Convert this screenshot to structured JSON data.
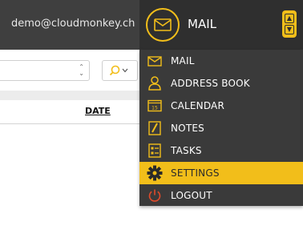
{
  "header": {
    "user_email": "demo@cloudmonkey.ch",
    "app_title": "MAIL"
  },
  "page": {
    "date_column_label": "DATE"
  },
  "menu": {
    "items": [
      {
        "label": "MAIL",
        "icon": "envelope-icon"
      },
      {
        "label": "ADDRESS BOOK",
        "icon": "person-icon"
      },
      {
        "label": "CALENDAR",
        "icon": "calendar-icon"
      },
      {
        "label": "NOTES",
        "icon": "notes-icon"
      },
      {
        "label": "TASKS",
        "icon": "tasks-icon"
      },
      {
        "label": "SETTINGS",
        "icon": "gear-icon",
        "active": true
      },
      {
        "label": "LOGOUT",
        "icon": "power-icon"
      }
    ]
  },
  "colors": {
    "accent": "#f2be1a",
    "topbar": "#3f3f3f",
    "menu_bg": "#3a3a3a",
    "logout_icon": "#e04a2a"
  }
}
